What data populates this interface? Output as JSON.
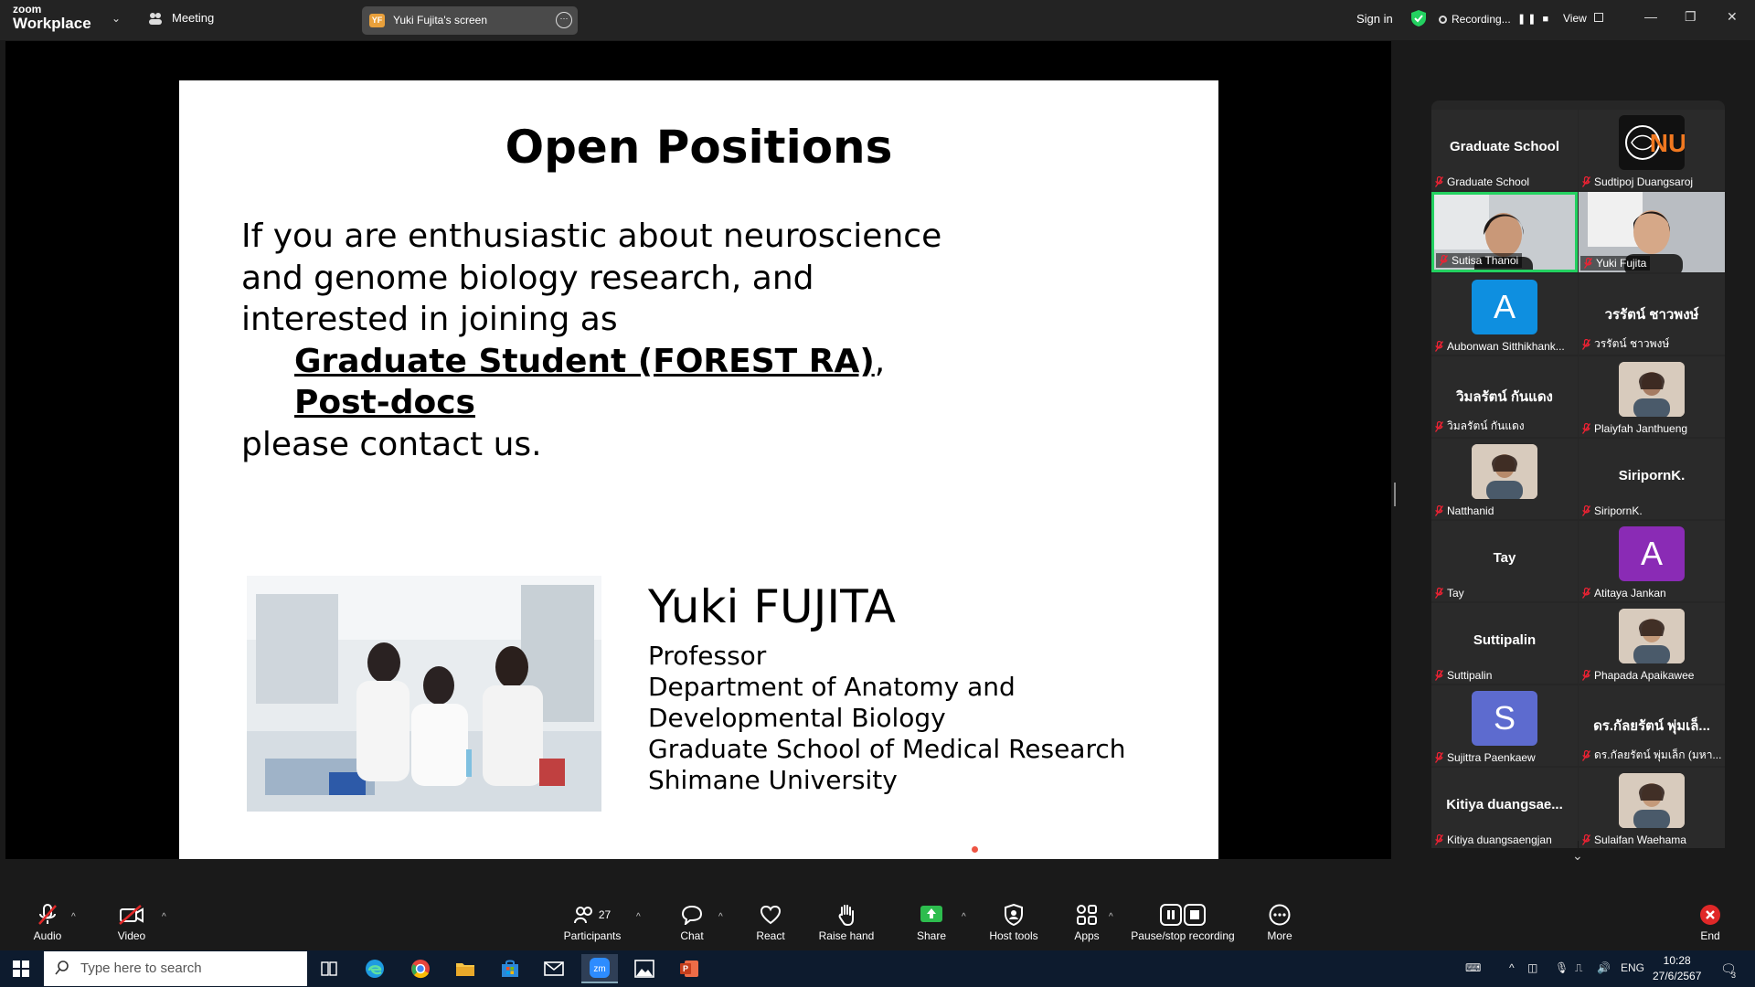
{
  "topbar": {
    "logo_line1": "zoom",
    "logo_line2": "Workplace",
    "meeting_label": "Meeting",
    "screen_badge": "YF",
    "screen_label": "Yuki Fujita's screen",
    "sign_in": "Sign in",
    "recording": "Recording...",
    "view": "View"
  },
  "slide": {
    "title": "Open Positions",
    "line1": "If you are enthusiastic about neuroscience",
    "line2": "and genome biology research, and",
    "line3": "interested in joining as",
    "pos1": "Graduate Student (FOREST RA)",
    "pos1_suffix": ",",
    "pos2": "Post-docs",
    "line4": "please contact us.",
    "name": "Yuki FUJITA",
    "role": "Professor",
    "dept1": "Department of Anatomy and",
    "dept2": "Developmental Biology",
    "school": "Graduate School of Medical Research",
    "univ": "Shimane University"
  },
  "participants": [
    {
      "name": "Graduate School",
      "display": "Graduate School",
      "type": "name"
    },
    {
      "name": "Sudtipoj Duangsaroj",
      "type": "logo",
      "logo_text": "NU"
    },
    {
      "name": "Sutisa Thanoi",
      "type": "video",
      "active": true
    },
    {
      "name": "Yuki Fujita",
      "type": "video"
    },
    {
      "name": "Aubonwan Sitthikhank...",
      "type": "avatar",
      "letter": "A",
      "color": "#0e8fe0"
    },
    {
      "name": "วรรัตน์ ชาวพงษ์",
      "display": "วรรัตน์ ชาวพงษ์",
      "type": "name"
    },
    {
      "name": "วิมลรัตน์ กันแดง",
      "display": "วิมลรัตน์ กันแดง",
      "type": "name"
    },
    {
      "name": "Plaiyfah Janthueng",
      "type": "photo"
    },
    {
      "name": "Natthanid",
      "type": "photo"
    },
    {
      "name": "SiripornK.",
      "display": "SiripornK.",
      "type": "name"
    },
    {
      "name": "Tay",
      "display": "Tay",
      "type": "name"
    },
    {
      "name": "Atitaya Jankan",
      "type": "avatar",
      "letter": "A",
      "color": "#8a2bb5"
    },
    {
      "name": "Suttipalin",
      "display": "Suttipalin",
      "type": "name"
    },
    {
      "name": "Phapada Apaikawee",
      "type": "photo"
    },
    {
      "name": "Sujittra Paenkaew",
      "type": "avatar",
      "letter": "S",
      "color": "#5d6bcf"
    },
    {
      "name": "ดร.กัลยรัตน์ พุ่มเล็ก (มหา...",
      "display": "ดร.กัลยรัตน์ พุ่มเล็...",
      "type": "name"
    },
    {
      "name": "Kitiya duangsaengjan",
      "display": "Kitiya  duangsae...",
      "type": "name"
    },
    {
      "name": "Sulaifan Waehama",
      "type": "photo"
    }
  ],
  "toolbar": {
    "audio": "Audio",
    "video": "Video",
    "participants": "Participants",
    "participants_count": "27",
    "chat": "Chat",
    "react": "React",
    "raise_hand": "Raise hand",
    "share": "Share",
    "host_tools": "Host tools",
    "apps": "Apps",
    "pause_stop": "Pause/stop recording",
    "more": "More",
    "end": "End"
  },
  "taskbar": {
    "search_placeholder": "Type here to search",
    "lang": "ENG",
    "time": "10:28",
    "date": "27/6/2567",
    "notif_count": "3"
  },
  "colors": {
    "accent_green": "#23d160",
    "end_red": "#e02828",
    "share_green": "#2dbd4e"
  }
}
